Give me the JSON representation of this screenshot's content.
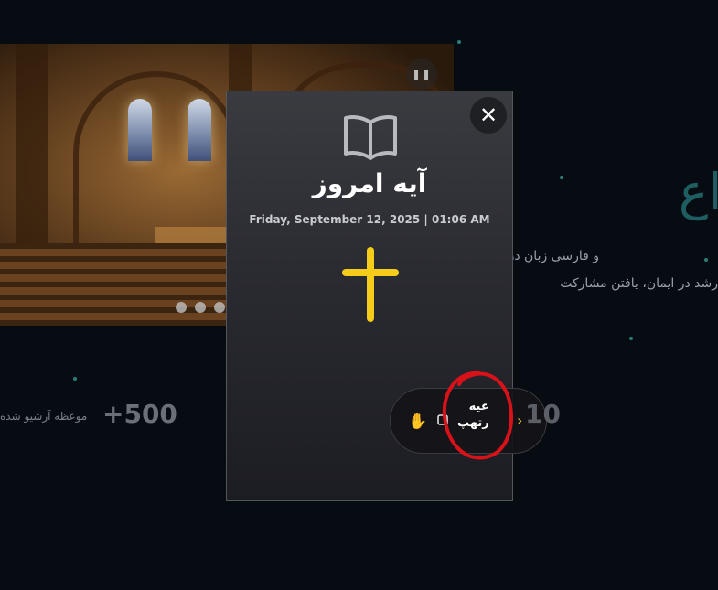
{
  "background": {
    "heading": "اع",
    "line1": "و فارسی زبان در قلب",
    "line2": "رشد در ایمان، یافتن مشارکت",
    "stat_number": "+500",
    "stat_label": "موعظه آرشیو شده",
    "slider_pause_icon": "pause-icon"
  },
  "modal": {
    "title": "آیه امروز",
    "date": "Friday, September 12, 2025 | 01:06 AM",
    "close_label": "✕",
    "icon": "open-book-icon",
    "cross_color": "#f5cc1a"
  },
  "toolbar": {
    "label": "عیه\nرتهپ",
    "number": "10",
    "hand_glyph": "✋",
    "chevron_glyph": "›",
    "accent_color": "#e6c029"
  },
  "annotation_color": "#d9121a"
}
